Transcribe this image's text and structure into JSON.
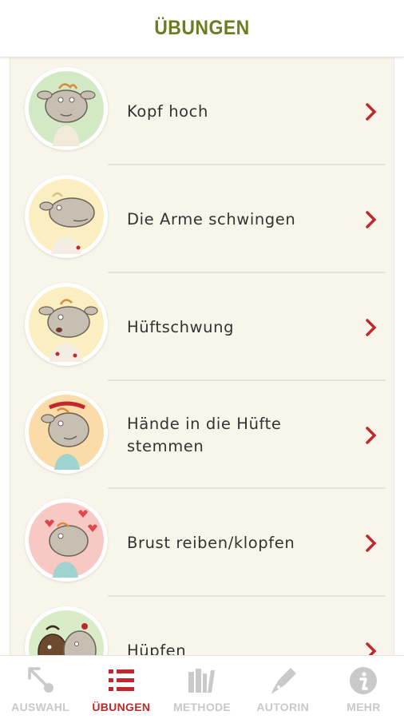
{
  "header": {
    "title": "ÜBUNGEN"
  },
  "colors": {
    "accent": "#c0282d",
    "title": "#6b7d1f",
    "panel": "#f8f6ea",
    "inactive": "#c9c9c9"
  },
  "exercises": [
    {
      "label": "Kopf hoch",
      "avatar_bg": "#d3e8c4",
      "icon": "sheep-head-up-avatar"
    },
    {
      "label": "Die Arme schwingen",
      "avatar_bg": "#fbeec0",
      "icon": "sheep-arms-swing-avatar"
    },
    {
      "label": "Hüftschwung",
      "avatar_bg": "#fbeec0",
      "icon": "sheep-hip-swing-avatar"
    },
    {
      "label": "Hände in die Hüfte stemmen",
      "avatar_bg": "#fbdca8",
      "icon": "sheep-hands-hips-avatar"
    },
    {
      "label": "Brust reiben/klopfen",
      "avatar_bg": "#f8c9c4",
      "icon": "sheep-chest-avatar"
    },
    {
      "label": "Hüpfen",
      "avatar_bg": "#d8ecc8",
      "icon": "sheep-jumping-avatar"
    }
  ],
  "tabs": [
    {
      "label": "AUSWAHL",
      "icon": "pointer-arrow-icon",
      "active": false
    },
    {
      "label": "ÜBUNGEN",
      "icon": "list-icon",
      "active": true
    },
    {
      "label": "METHODE",
      "icon": "books-icon",
      "active": false
    },
    {
      "label": "AUTORIN",
      "icon": "fountain-pen-icon",
      "active": false
    },
    {
      "label": "MEHR",
      "icon": "info-icon",
      "active": false
    }
  ]
}
